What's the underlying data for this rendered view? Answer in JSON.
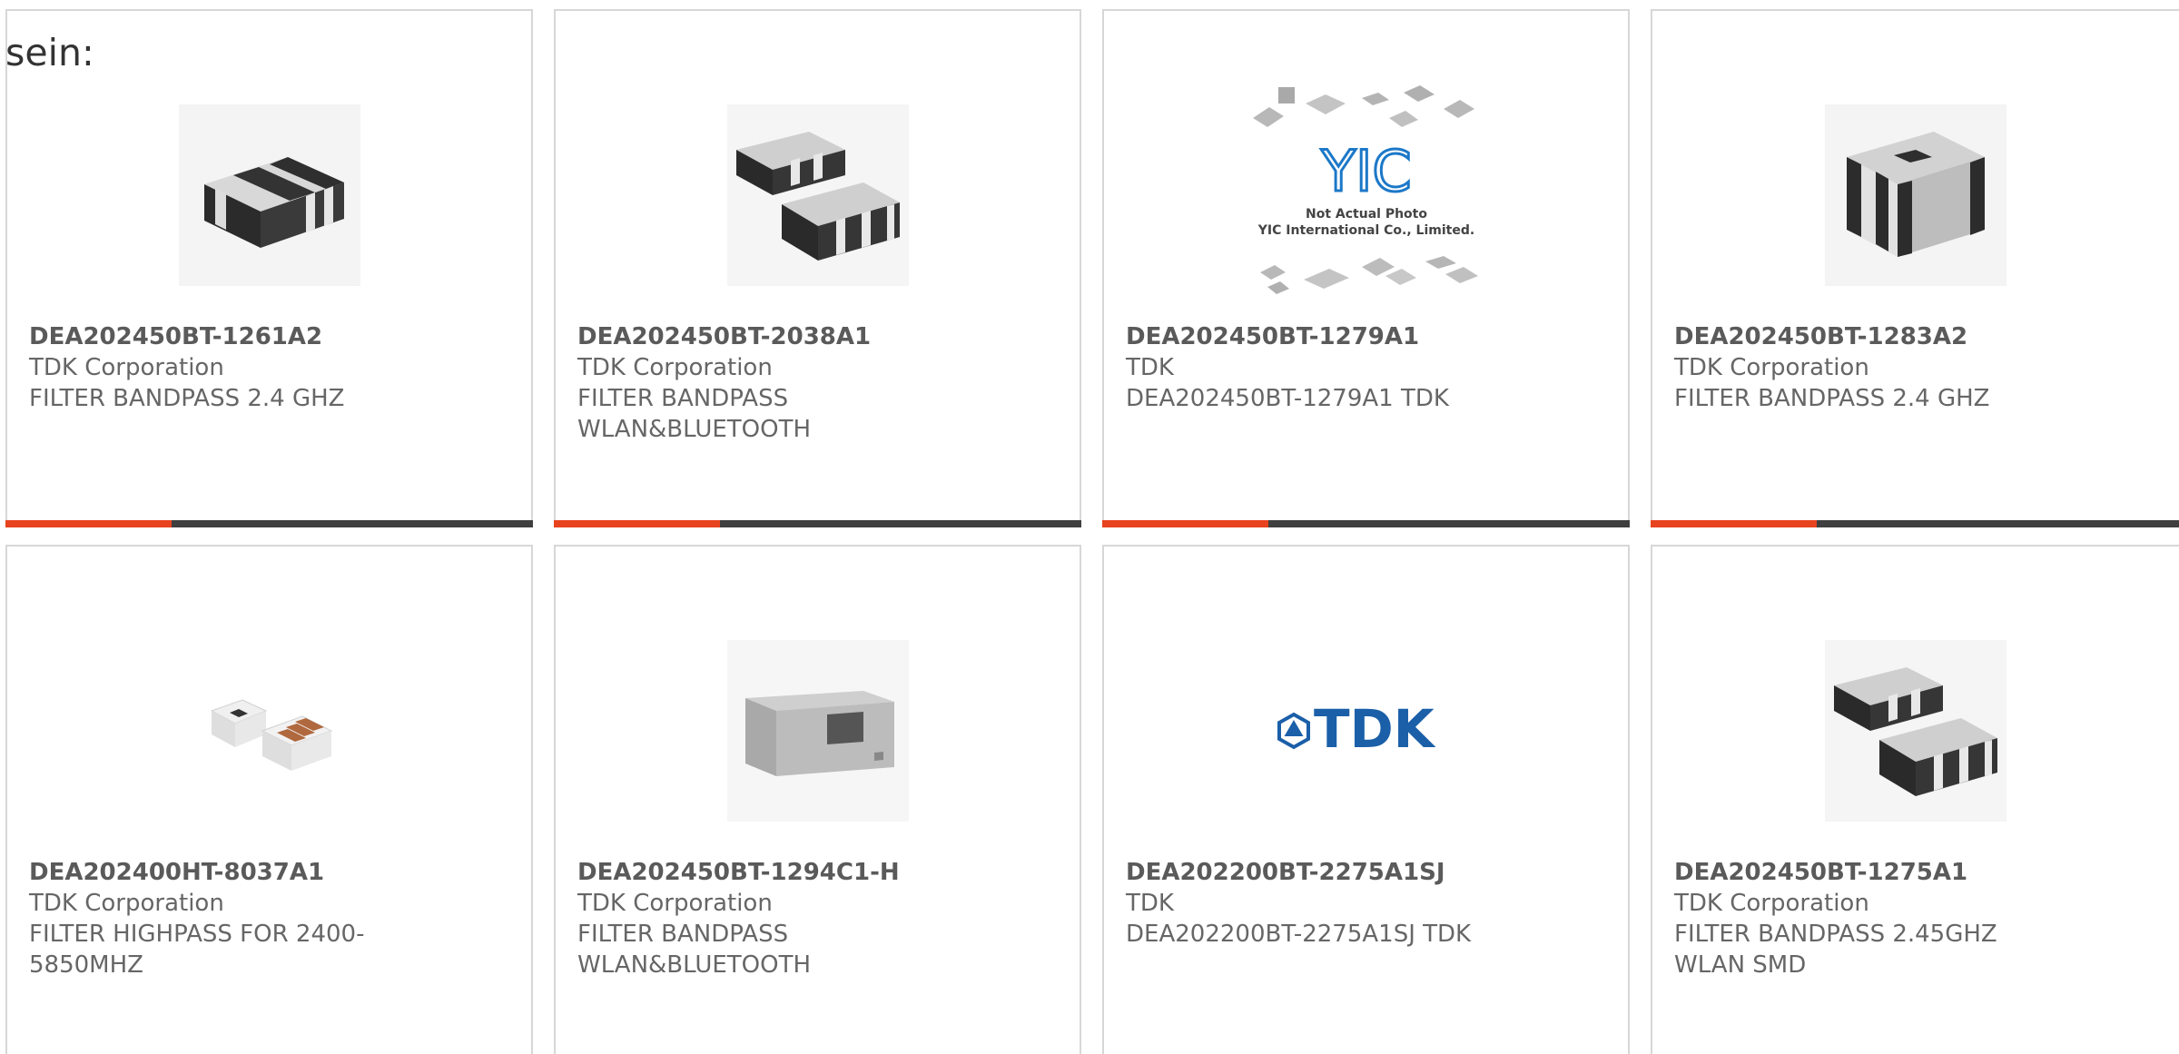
{
  "intro_text": "sein:",
  "colors": {
    "accent": "#e8431f",
    "bar": "#3f3f3f",
    "border": "#d7d7d7",
    "tdk_blue": "#1a5fa8"
  },
  "products": [
    {
      "part_number": "DEA202450BT-1261A2",
      "manufacturer": "TDK Corporation",
      "description": "FILTER BANDPASS 2.4 GHZ",
      "image": "filter-chip-2-band-icon"
    },
    {
      "part_number": "DEA202450BT-2038A1",
      "manufacturer": "TDK Corporation",
      "description": "FILTER BANDPASS WLAN&BLUETOOTH",
      "image": "filter-chip-pair-icon"
    },
    {
      "part_number": "DEA202450BT-1279A1",
      "manufacturer": "TDK",
      "description": "DEA202450BT-1279A1 TDK",
      "image": "yic-placeholder-icon"
    },
    {
      "part_number": "DEA202450BT-1283A2",
      "manufacturer": "TDK Corporation",
      "description": "FILTER BANDPASS 2.4 GHZ",
      "image": "filter-chip-tall-icon"
    },
    {
      "part_number": "DEA202400HT-8037A1",
      "manufacturer": "TDK Corporation",
      "description": "FILTER HIGHPASS FOR 2400-5850MHZ",
      "image": "highpass-chip-pair-icon"
    },
    {
      "part_number": "DEA202450BT-1294C1-H",
      "manufacturer": "TDK Corporation",
      "description": "FILTER BANDPASS WLAN&BLUETOOTH",
      "image": "gray-module-icon"
    },
    {
      "part_number": "DEA202200BT-2275A1SJ",
      "manufacturer": "TDK",
      "description": "DEA202200BT-2275A1SJ TDK",
      "image": "tdk-logo-icon"
    },
    {
      "part_number": "DEA202450BT-1275A1",
      "manufacturer": "TDK Corporation",
      "description": "FILTER BANDPASS 2.45GHZ WLAN SMD",
      "image": "filter-chip-pair-icon"
    }
  ],
  "placeholder_image": {
    "logo_text": "YIC",
    "line1": "Not Actual Photo",
    "line2": "YIC International Co., Limited."
  },
  "tdk_logo_text": "TDK"
}
